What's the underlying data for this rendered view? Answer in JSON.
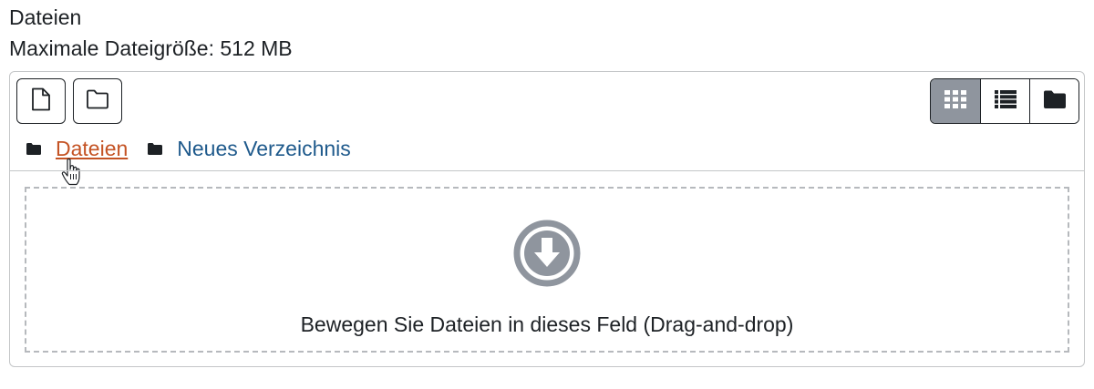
{
  "field": {
    "label": "Dateien",
    "max_size": "Maximale Dateigröße: 512 MB"
  },
  "toolbar": {
    "add_file_icon": "file-icon",
    "add_folder_icon": "folder-outline-icon"
  },
  "view_modes": [
    {
      "icon": "grid-icon",
      "active": true
    },
    {
      "icon": "list-icon",
      "active": false
    },
    {
      "icon": "folder-tree-icon",
      "active": false
    }
  ],
  "breadcrumb": {
    "items": [
      {
        "label": "Dateien"
      },
      {
        "label": "Neues Verzeichnis"
      }
    ]
  },
  "dropzone": {
    "text": "Bewegen Sie Dateien in dieses Feld (Drag-and-drop)"
  },
  "colors": {
    "link": "#1f5a8c",
    "link_hover": "#c45324",
    "active_view": "#8f959e",
    "dropzone_icon": "#8f959e"
  }
}
